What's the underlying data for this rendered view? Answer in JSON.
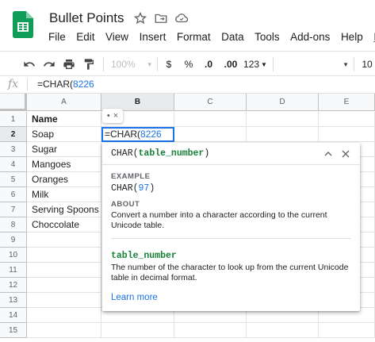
{
  "app": {
    "doc_title": "Bullet Points",
    "menu": [
      "File",
      "Edit",
      "View",
      "Insert",
      "Format",
      "Data",
      "Tools",
      "Add-ons",
      "Help",
      "La"
    ]
  },
  "toolbar": {
    "zoom": "100%",
    "currency": "$",
    "percent": "%",
    "dec_decrease": ".0",
    "dec_increase": ".00",
    "more_formats": "123",
    "font_size": "10"
  },
  "formula_bar": {
    "fx": "fx",
    "formula_prefix": "=CHAR(",
    "formula_number": "8226"
  },
  "grid": {
    "columns": [
      "A",
      "B",
      "C",
      "D",
      "E"
    ],
    "rows": [
      "1",
      "2",
      "3",
      "4",
      "5",
      "6",
      "7",
      "8",
      "9",
      "10",
      "11",
      "12",
      "13",
      "14",
      "15"
    ],
    "cells_a": [
      "Name",
      "Soap",
      "Sugar",
      "Mangoes",
      "Oranges",
      "Milk",
      "Serving Spoons",
      "Choccolate"
    ],
    "active_cell_prefix": "=CHAR(",
    "active_cell_number": "8226",
    "mini_popup": {
      "dot": "•",
      "close": "×"
    }
  },
  "help_popup": {
    "signature_fn": "CHAR(",
    "signature_arg": "table_number",
    "signature_end": ")",
    "example_label": "EXAMPLE",
    "example_fn": "CHAR(",
    "example_num": "97",
    "example_end": ")",
    "about_label": "ABOUT",
    "about_text": "Convert a number into a character according to the current Unicode table.",
    "arg_name": "table_number",
    "arg_desc": "The number of the character to look up from the current Unicode table in decimal format.",
    "learn_more": "Learn more"
  },
  "colors": {
    "accent": "#1a73e8",
    "arg_green": "#188038",
    "sheets_green": "#0f9d58"
  }
}
